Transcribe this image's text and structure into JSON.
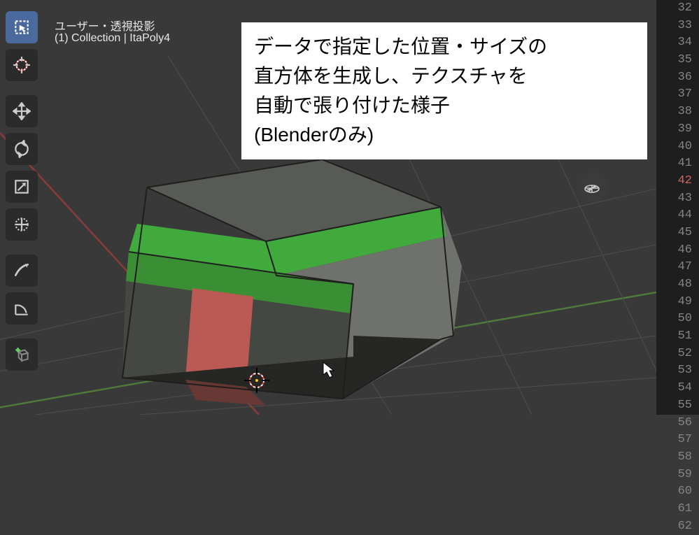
{
  "header": {
    "title": "ユーザー・透視投影",
    "subtitle": "(1) Collection | ItaPoly4"
  },
  "annotation": {
    "line1": "データで指定した位置・サイズの",
    "line2": "直方体を生成し、テクスチャを",
    "line3": "自動で張り付けた様子",
    "line4": "(Blenderのみ)"
  },
  "tools": {
    "select": "select-box-icon",
    "cursor": "cursor-icon",
    "move": "move-icon",
    "rotate": "rotate-icon",
    "scale": "scale-icon",
    "transform": "transform-icon",
    "annotate": "annotate-icon",
    "measure": "measure-icon",
    "add": "add-cube-icon"
  },
  "gizmo": {
    "grid": "viewport-grid-icon"
  },
  "gutter": {
    "start": 32,
    "end": 62,
    "highlighted": 42
  },
  "colors": {
    "bg": "#393939",
    "toolbar": "#2b2b2b",
    "active": "#4a6a9e",
    "gutter_bg": "#1e1e1e",
    "gutter_fg": "#858585",
    "gutter_hl": "#cc6666",
    "cube_top_dark": "#585a55",
    "cube_top_green": "#40aa3c",
    "cube_front_green": "#3a8f35",
    "cube_front_dark": "#454742",
    "cube_front_red": "#bb5a55",
    "cube_side_gray": "#6f716c",
    "floor_dark": "#2b2d2a"
  }
}
